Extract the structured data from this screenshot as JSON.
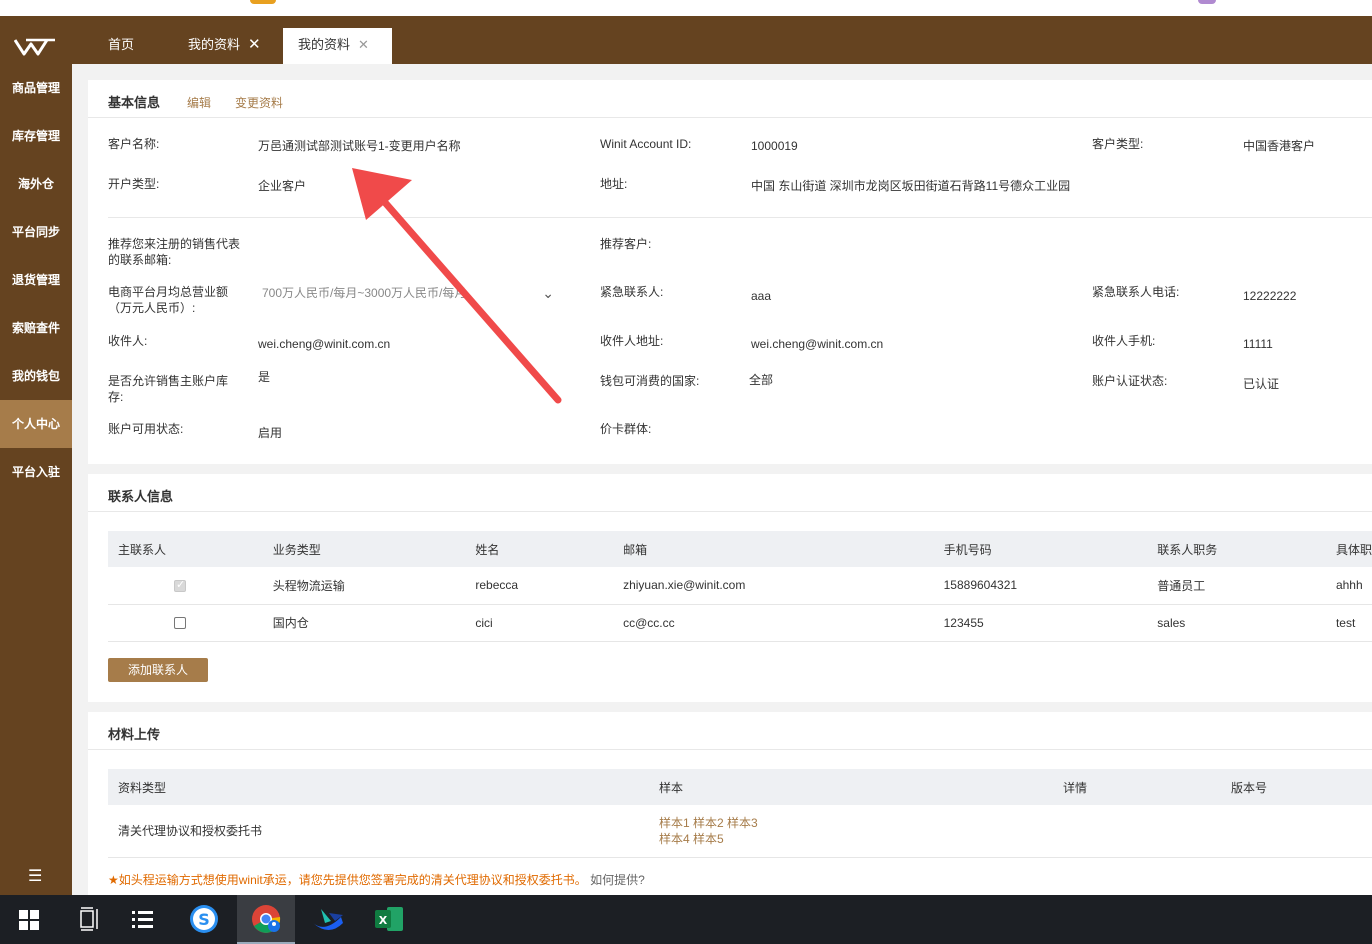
{
  "tabs": [
    {
      "label": "首页"
    },
    {
      "label": "我的资料",
      "close": "✕"
    },
    {
      "label": "我的资料",
      "close": "✕"
    }
  ],
  "sidebar": {
    "items": [
      {
        "label": "商品管理"
      },
      {
        "label": "库存管理"
      },
      {
        "label": "海外仓"
      },
      {
        "label": "平台同步"
      },
      {
        "label": "退货管理"
      },
      {
        "label": "索赔查件"
      },
      {
        "label": "我的钱包"
      },
      {
        "label": "个人中心",
        "active": true
      },
      {
        "label": "平台入驻"
      }
    ],
    "collapse_icon": "☰"
  },
  "basic": {
    "title": "基本信息",
    "edit": "编辑",
    "change": "变更资料",
    "customer_name_label": "客户名称:",
    "customer_name": "万邑通测试部测试账号1-变更用户名称",
    "account_id_label": "Winit Account ID:",
    "account_id": "1000019",
    "customer_type_label": "客户类型:",
    "customer_type": "中国香港客户",
    "account_type_label": "开户类型:",
    "account_type": "企业客户",
    "address_label": "地址:",
    "address": "中国 东山街道 深圳市龙岗区坂田街道石背路11号德众工业园",
    "sales_email_label": "推荐您来注册的销售代表的联系邮箱:",
    "referrer_label": "推荐客户:",
    "revenue_label": "电商平台月均总营业额（万元人民币）:",
    "revenue_value": "700万人民币/每月~3000万人民币/每月",
    "emergency_contact_label": "紧急联系人:",
    "emergency_contact": "aaa",
    "emergency_phone_label": "紧急联系人电话:",
    "emergency_phone": "12222222",
    "recipient_label": "收件人:",
    "recipient": "wei.cheng@winit.com.cn",
    "recipient_address_label": "收件人地址:",
    "recipient_address": "wei.cheng@winit.com.cn",
    "recipient_mobile_label": "收件人手机:",
    "recipient_mobile": "11111",
    "allow_sales_label": "是否允许销售主账户库存:",
    "allow_sales": "是",
    "wallet_countries_label": "钱包可消费的国家:",
    "wallet_countries": "全部",
    "auth_status_label": "账户认证状态:",
    "auth_status": "已认证",
    "available_label": "账户可用状态:",
    "available": "启用",
    "price_group_label": "价卡群体:"
  },
  "contacts": {
    "title": "联系人信息",
    "headers": [
      "主联系人",
      "业务类型",
      "姓名",
      "邮箱",
      "手机号码",
      "联系人职务",
      "具体职"
    ],
    "rows": [
      {
        "primary": true,
        "biz": "头程物流运输",
        "name": "rebecca",
        "email": "zhiyuan.xie@winit.com",
        "phone": "15889604321",
        "role": "普通员工",
        "detail": "ahhh"
      },
      {
        "primary": false,
        "biz": "国内仓",
        "name": "cici",
        "email": "cc@cc.cc",
        "phone": "123455",
        "role": "sales",
        "detail": "test"
      }
    ],
    "add_button": "添加联系人"
  },
  "materials": {
    "title": "材料上传",
    "headers": [
      "资料类型",
      "样本",
      "详情",
      "版本号"
    ],
    "row_type": "清关代理协议和授权委托书",
    "samples_line1": "样本1 样本2 样本3",
    "samples_line2": "样本4 样本5",
    "notice": "★如头程运输方式想使用winit承运，请您先提供您签署完成的清关代理协议和授权委托书。",
    "how": "如何提供?"
  },
  "colors": {
    "brand": "#654320",
    "accent": "#a67c4a",
    "arrow": "#f04a4a"
  },
  "taskbar": [
    "windows-start-icon",
    "task-view-icon",
    "list-app-icon",
    "sogou-icon",
    "chrome-icon",
    "feishu-icon",
    "excel-icon"
  ]
}
